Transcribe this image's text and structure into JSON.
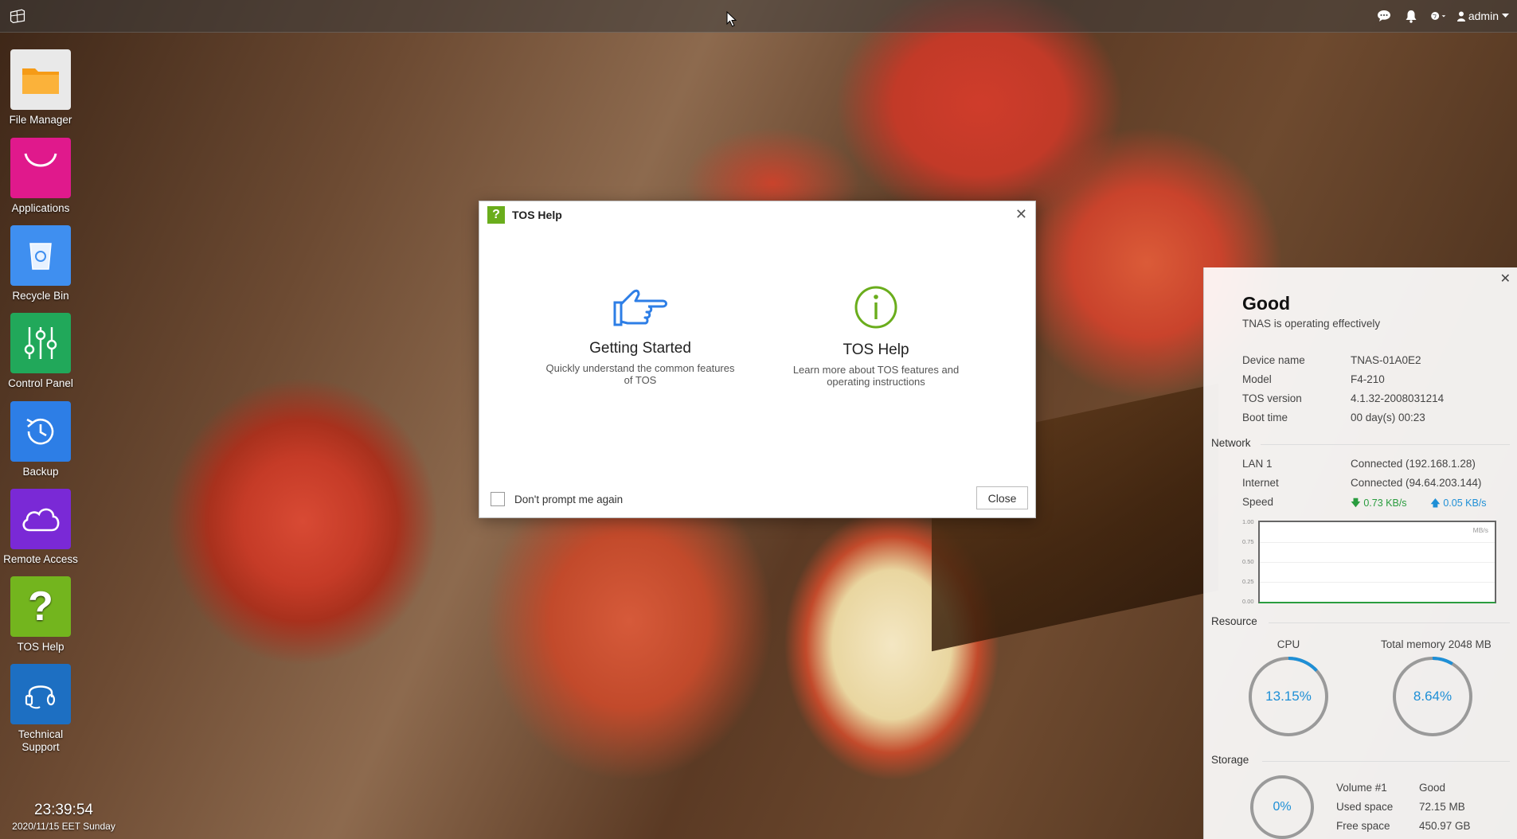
{
  "topbar": {
    "user_label": "admin"
  },
  "desktop": {
    "icons": [
      {
        "label": "File Manager"
      },
      {
        "label": "Applications"
      },
      {
        "label": "Recycle Bin"
      },
      {
        "label": "Control Panel"
      },
      {
        "label": "Backup"
      },
      {
        "label": "Remote Access"
      },
      {
        "label": "TOS Help"
      },
      {
        "label": "Technical Support"
      }
    ]
  },
  "clock": {
    "time": "23:39:54",
    "date": "2020/11/15 EET Sunday"
  },
  "dialog": {
    "title": "TOS Help",
    "options": [
      {
        "title": "Getting Started",
        "description": "Quickly understand the common features of TOS"
      },
      {
        "title": "TOS Help",
        "description": "Learn more about TOS features and operating instructions"
      }
    ],
    "checkbox_label": "Don't prompt me again",
    "close_label": "Close"
  },
  "status": {
    "headline": "Good",
    "subtitle": "TNAS is operating effectively",
    "device": [
      {
        "key": "Device name",
        "value": "TNAS-01A0E2"
      },
      {
        "key": "Model",
        "value": "F4-210"
      },
      {
        "key": "TOS version",
        "value": "4.1.32-2008031214"
      },
      {
        "key": "Boot time",
        "value": "00 day(s) 00:23"
      }
    ],
    "network_title": "Network",
    "network": [
      {
        "key": "LAN 1",
        "value": "Connected (192.168.1.28)"
      },
      {
        "key": "Internet",
        "value": "Connected (94.64.203.144)"
      }
    ],
    "speed_label": "Speed",
    "download": "0.73 KB/s",
    "upload": "0.05 KB/s",
    "graph": {
      "unit": "MB/s",
      "ticks": [
        "1.00",
        "0.75",
        "0.50",
        "0.25",
        "0.00"
      ]
    },
    "resource_title": "Resource",
    "cpu_label": "CPU",
    "cpu_value": "13.15%",
    "cpu_fraction": 0.1315,
    "memory_label": "Total memory 2048 MB",
    "memory_value": "8.64%",
    "memory_fraction": 0.0864,
    "storage_title": "Storage",
    "storage_value": "0%",
    "storage": [
      {
        "key": "Volume #1",
        "value": "Good"
      },
      {
        "key": "Used space",
        "value": "72.15 MB"
      },
      {
        "key": "Free space",
        "value": "450.97 GB"
      }
    ]
  },
  "colors": {
    "accent_blue": "#1e8fd6",
    "help_green": "#6aad1c",
    "download_green": "#2a9c3f"
  }
}
